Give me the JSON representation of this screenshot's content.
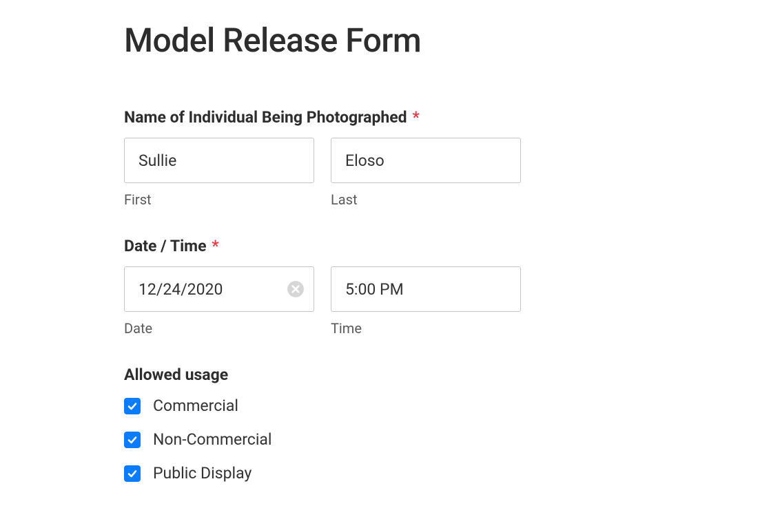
{
  "title": "Model Release Form",
  "name_section": {
    "label": "Name of Individual Being Photographed",
    "first": {
      "value": "Sullie",
      "sublabel": "First"
    },
    "last": {
      "value": "Eloso",
      "sublabel": "Last"
    }
  },
  "datetime_section": {
    "label": "Date / Time",
    "date": {
      "value": "12/24/2020",
      "sublabel": "Date"
    },
    "time": {
      "value": "5:00 PM",
      "sublabel": "Time"
    }
  },
  "usage_section": {
    "label": "Allowed usage",
    "options": {
      "commercial": "Commercial",
      "non_commercial": "Non-Commercial",
      "public_display": "Public Display"
    }
  }
}
